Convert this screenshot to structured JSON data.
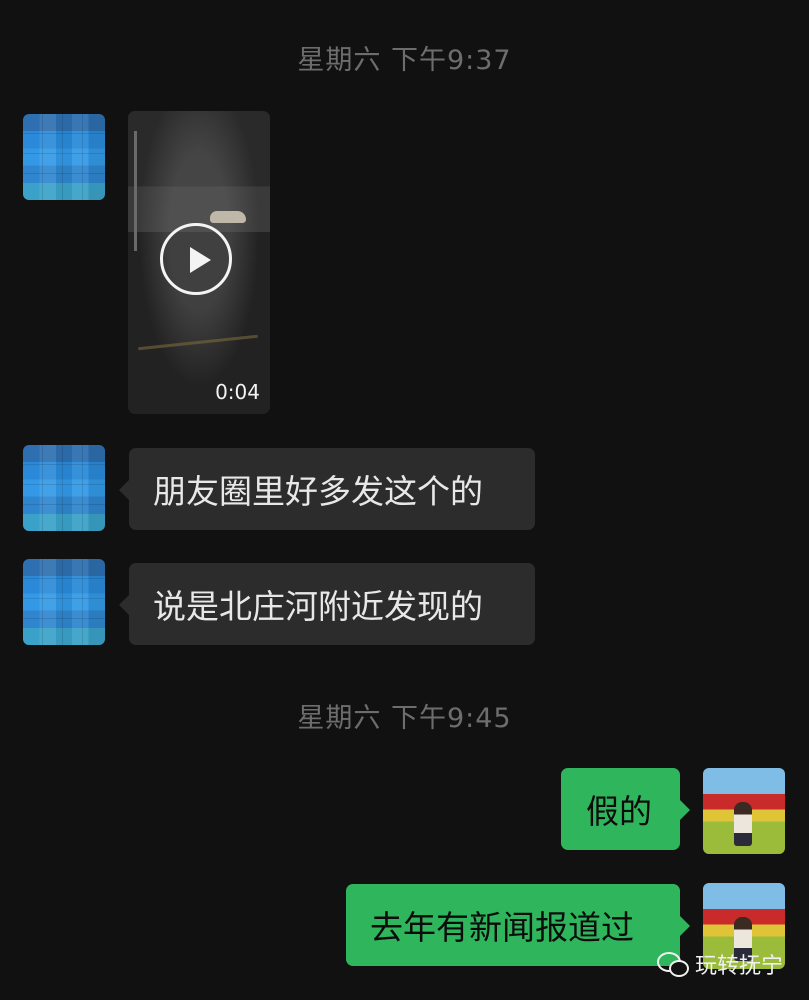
{
  "timestamps": [
    "星期六 下午9:37",
    "星期六 下午9:45"
  ],
  "video_message": {
    "duration": "0:04",
    "icon": "play-icon"
  },
  "messages_incoming": [
    "朋友圈里好多发这个的",
    "说是北庄河附近发现的"
  ],
  "messages_outgoing": [
    "假的",
    "去年有新闻报道过"
  ],
  "watermark": {
    "text": "玩转抚宁",
    "icon": "wechat-icon"
  },
  "colors": {
    "background": "#111111",
    "incoming_bubble": "#2c2c2c",
    "outgoing_bubble": "#2fb65c",
    "timestamp_text": "#6d6d6d"
  }
}
